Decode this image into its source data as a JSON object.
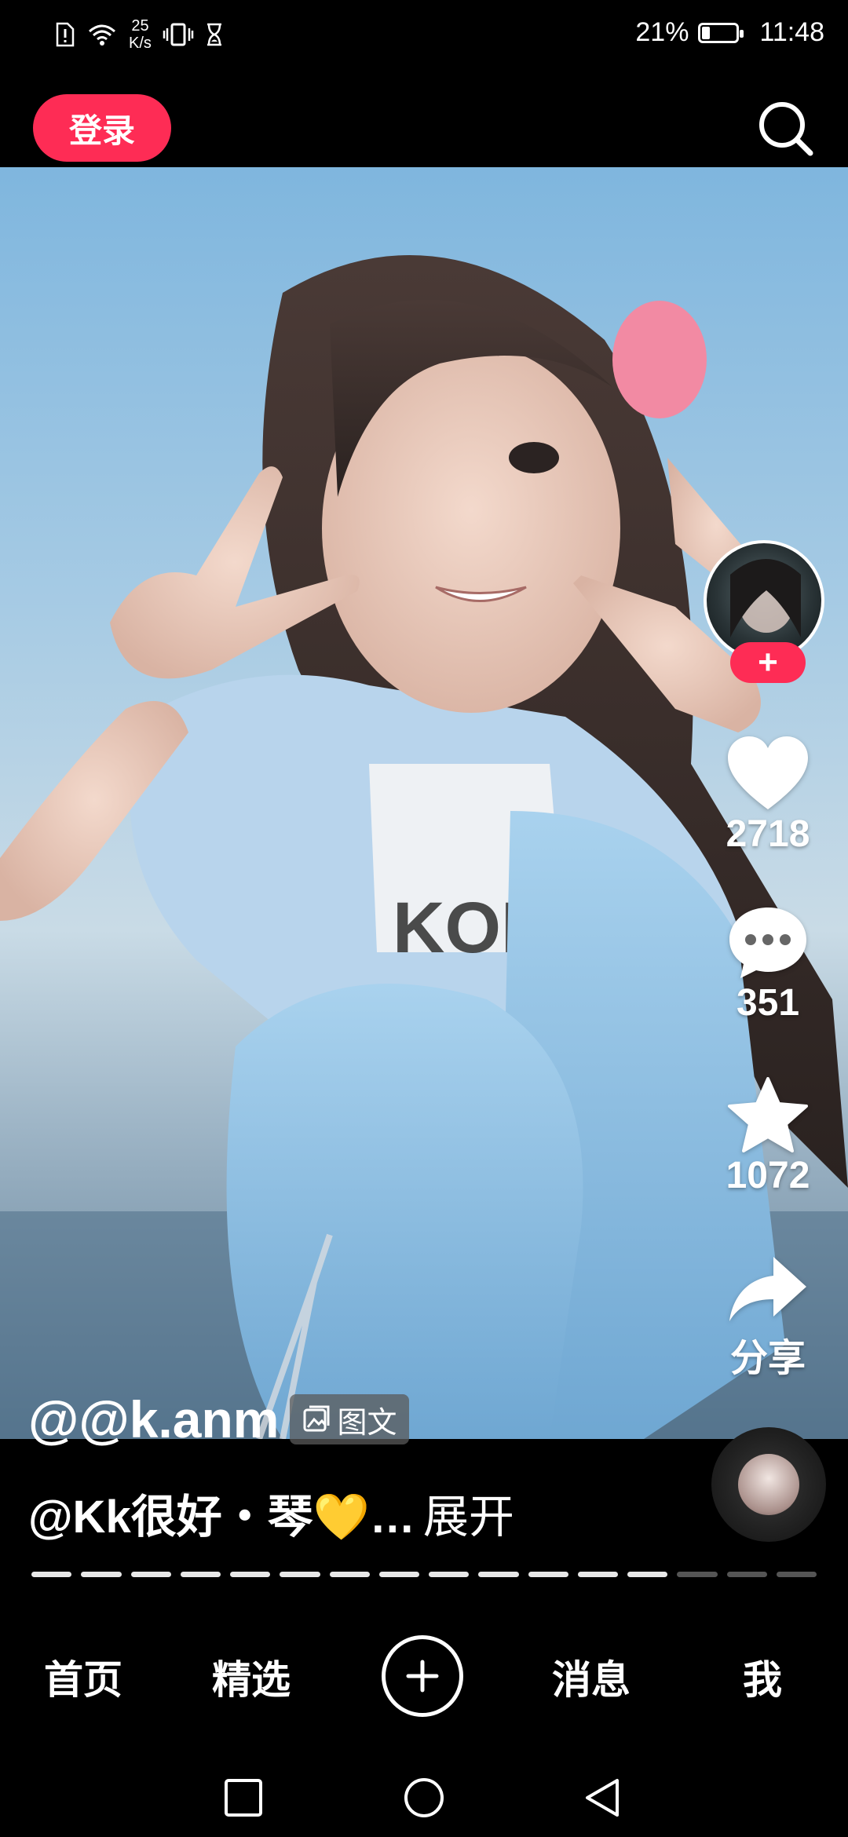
{
  "status_bar": {
    "net_speed_value": "25",
    "net_speed_unit": "K/s",
    "battery_percent": "21%",
    "battery_level": 0.21,
    "time": "11:48"
  },
  "top_bar": {
    "login_label": "登录",
    "search_icon": "search-icon"
  },
  "side_actions": {
    "follow_icon": "plus-icon",
    "likes": "2718",
    "comments": "351",
    "favorites": "1072",
    "share_label": "分享"
  },
  "post": {
    "author": "@@k.anm",
    "tag_label": "图文",
    "desc_text": "@Kk很好・琴💛…",
    "expand_label": "展开"
  },
  "progress": {
    "segments_total": 16,
    "segments_done": 13
  },
  "bottom_nav": {
    "home": "首页",
    "featured": "精选",
    "create_icon": "plus-icon",
    "messages": "消息",
    "me": "我"
  },
  "system_nav": [
    "square-icon",
    "circle-icon",
    "triangle-back-icon"
  ]
}
